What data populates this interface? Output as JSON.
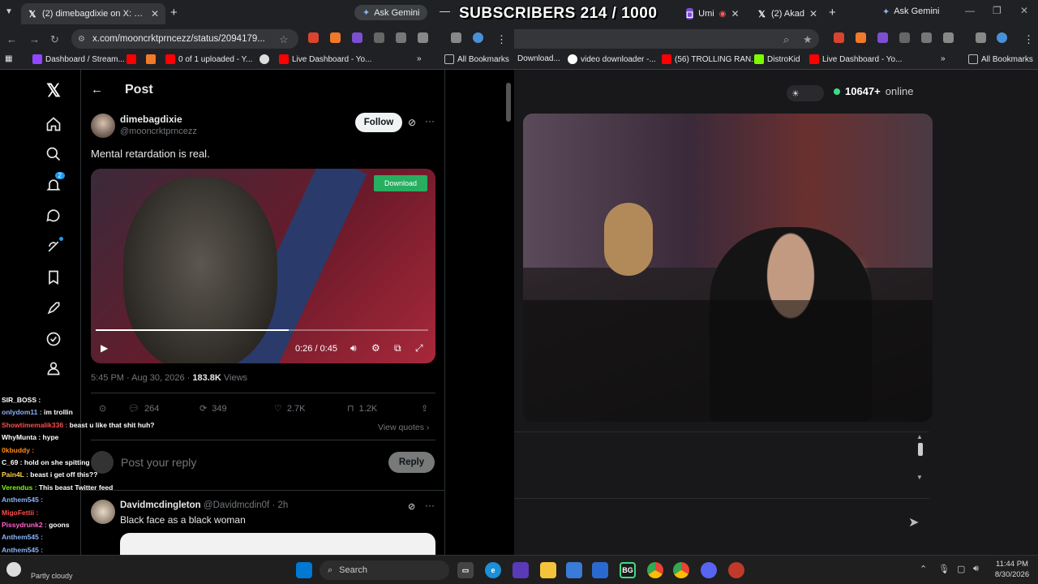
{
  "overlay": {
    "subscribers": "SUBSCRIBERS 214 / 1000"
  },
  "left_browser": {
    "tabs": [
      {
        "title": "(2) dimebagdixie on X: \"Mental"
      }
    ],
    "ask_gemini": "Ask Gemini",
    "url": "x.com/mooncrktprncezz/status/2094179...",
    "bookmarks": [
      "Dashboard / Stream...",
      "0 of 1 uploaded - Y...",
      "Live Dashboard - Yo..."
    ],
    "all_bookmarks": "All Bookmarks"
  },
  "right_browser": {
    "tabs": [
      {
        "title": "Umi"
      },
      {
        "title": "(2) Akad"
      }
    ],
    "ask_gemini": "Ask Gemini",
    "bookmarks": [
      "Download...",
      "video downloader -...",
      "(56) TROLLING RAN...",
      "DistroKid",
      "Live Dashboard - Yo..."
    ],
    "all_bookmarks": "All Bookmarks"
  },
  "x": {
    "header_title": "Post",
    "notification_count": "2",
    "post": {
      "display_name": "dimebagdixie",
      "handle": "@mooncrktprncezz",
      "follow_label": "Follow",
      "text": "Mental retardation is real.",
      "download_label": "Download",
      "video_time": "0:26 / 0:45",
      "video_progress": 0.58,
      "timestamp": "5:45 PM · Aug 30, 2026 · ",
      "views_count": "183.8K",
      "views_label": "Views",
      "replies": "264",
      "reposts": "349",
      "likes": "2.7K",
      "bookmarks": "1.2K",
      "view_quotes": "View quotes"
    },
    "reply_box": {
      "placeholder": "Post your reply",
      "button": "Reply"
    },
    "reply": {
      "display_name": "Davidmcdingleton",
      "handle": "@Davidmcdin0f",
      "time": "· 2h",
      "text": "Black face as a black woman"
    }
  },
  "chat": [
    {
      "user": "SIR_BOSS :",
      "msg": "",
      "color": "#ffffff"
    },
    {
      "user": "onlydom11 :",
      "msg": "im trollin",
      "color": "#8ab4f8"
    },
    {
      "user": "Showtimemalik336 :",
      "msg": "beast u like that shit huh?",
      "color": "#ff4d4d"
    },
    {
      "user": "WhyMunta :",
      "msg": "hype",
      "color": "#ffffff"
    },
    {
      "user": "0kbuddy :",
      "msg": "",
      "color": "#ff8c1a"
    },
    {
      "user": "C_69 :",
      "msg": "hold on she spitting",
      "color": "#ffffff"
    },
    {
      "user": "Pain4L :",
      "msg": "beast i get off this??",
      "color": "#ffd24d"
    },
    {
      "user": "Verendus :",
      "msg": "This beast Twitter feed",
      "color": "#7CFC00"
    },
    {
      "user": "Anthem545 :",
      "msg": "",
      "color": "#8ab4f8"
    },
    {
      "user": "MigoFettii :",
      "msg": "",
      "color": "#ff4d4d"
    },
    {
      "user": "Pissydrunk2 :",
      "msg": "goons",
      "color": "#ff66cc"
    },
    {
      "user": "Anthem545 :",
      "msg": "",
      "color": "#8ab4f8"
    },
    {
      "user": "Anthem545 :",
      "msg": "",
      "color": "#8ab4f8"
    }
  ],
  "stream": {
    "online_count": "10647+",
    "online_label": "online"
  },
  "taskbar": {
    "weather": "Partly cloudy",
    "search": "Search",
    "time": "11:44 PM",
    "date": "8/30/2026"
  }
}
